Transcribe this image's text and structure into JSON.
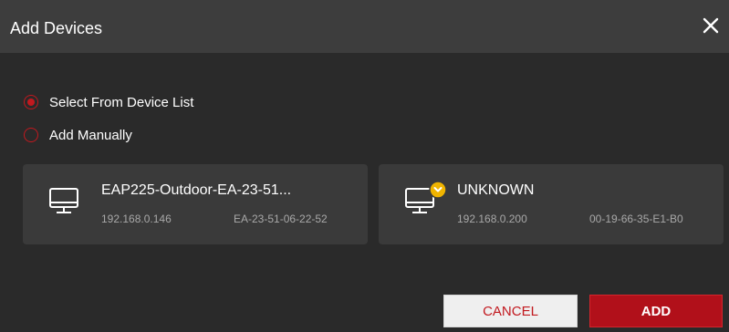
{
  "dialog": {
    "title": "Add Devices",
    "close_icon": "close-icon"
  },
  "mode": {
    "options": [
      {
        "label": "Select From Device List",
        "selected": true
      },
      {
        "label": "Add Manually",
        "selected": false
      }
    ]
  },
  "devices": [
    {
      "name": "EAP225-Outdoor-EA-23-51...",
      "ip": "192.168.0.146",
      "mac": "EA-23-51-06-22-52",
      "icon": "monitor-icon",
      "badge": null
    },
    {
      "name": "UNKNOWN",
      "ip": "192.168.0.200",
      "mac": "00-19-66-35-E1-B0",
      "icon": "monitor-icon",
      "badge": "download-badge-icon"
    }
  ],
  "actions": {
    "cancel_label": "CANCEL",
    "add_label": "ADD"
  },
  "colors": {
    "accent": "#c2191f",
    "badge": "#f0b400"
  }
}
